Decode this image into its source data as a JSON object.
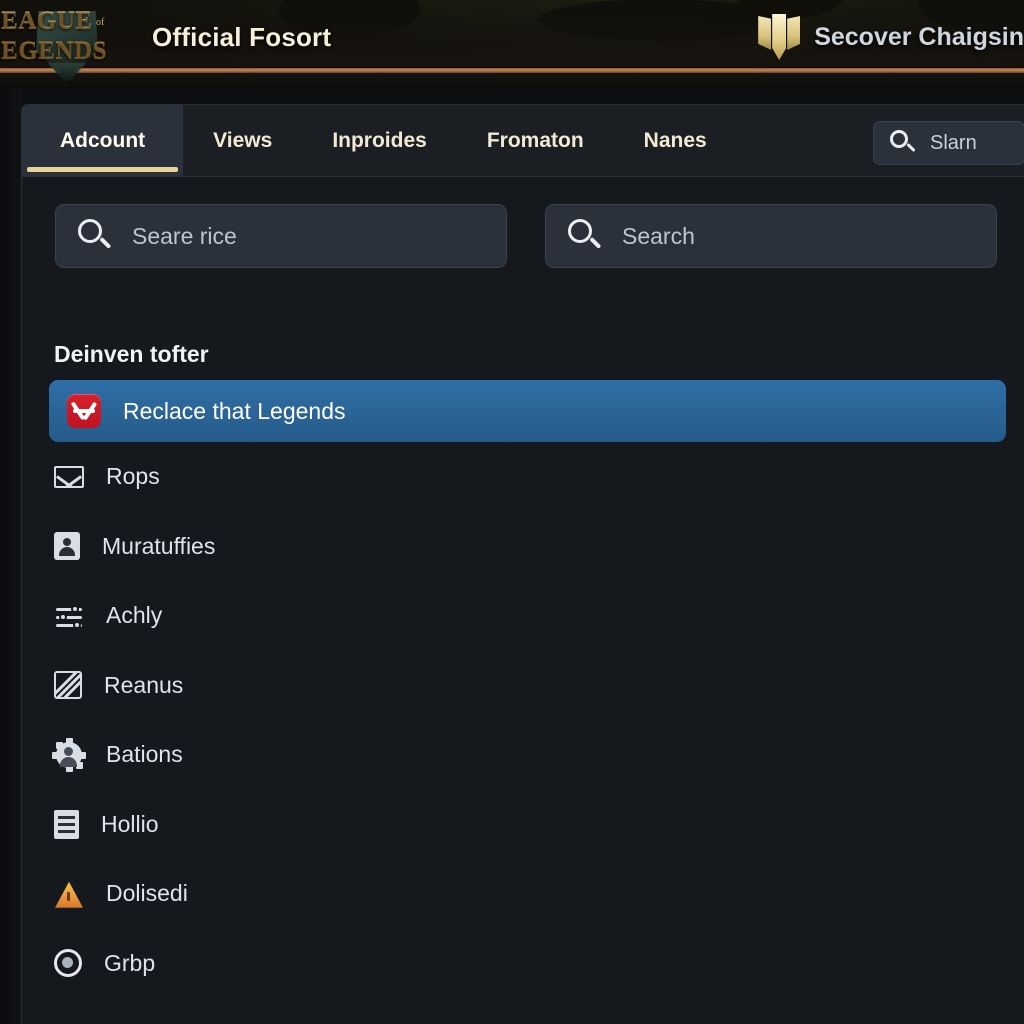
{
  "header": {
    "logo_line1": "LEAGUE",
    "logo_line2": "LEGENDS",
    "logo_of": "of",
    "title": "Official Fosort",
    "right_icon": "book-emblem-icon",
    "right_text": "Secover Chaigsin"
  },
  "tabs": [
    {
      "label": "Adcount",
      "active": true
    },
    {
      "label": "Views",
      "active": false
    },
    {
      "label": "Inproides",
      "active": false
    },
    {
      "label": "Fromaton",
      "active": false
    },
    {
      "label": "Nanes",
      "active": false
    }
  ],
  "tab_search": {
    "icon": "search-icon",
    "value": "Slarn"
  },
  "search_fields": [
    {
      "icon": "search-icon",
      "placeholder": "Seare rice"
    },
    {
      "icon": "search-icon",
      "placeholder": "Search"
    }
  ],
  "section": {
    "heading": "Deinven tofter"
  },
  "list": [
    {
      "label": "Reclace that Legends",
      "icon": "red-x-tile-icon",
      "selected": true
    },
    {
      "label": "Rops",
      "icon": "envelope-icon",
      "selected": false
    },
    {
      "label": "Muratuffies",
      "icon": "contact-card-icon",
      "selected": false
    },
    {
      "label": "Achly",
      "icon": "sliders-icon",
      "selected": false
    },
    {
      "label": "Reanus",
      "icon": "no-image-hatch-icon",
      "selected": false
    },
    {
      "label": "Bations",
      "icon": "gear-person-icon",
      "selected": false
    },
    {
      "label": "Hollio",
      "icon": "document-lines-icon",
      "selected": false
    },
    {
      "label": "Dolisedi",
      "icon": "warning-triangle-icon",
      "selected": false
    },
    {
      "label": "Grbp",
      "icon": "target-ring-icon",
      "selected": false
    }
  ],
  "colors": {
    "panel_bg": "#15181d",
    "tabbar_bg": "#1b1e22",
    "active_tab_bg": "#2b313b",
    "active_tab_underline": "#e8d39a",
    "selected_row_blue": "#2b6496",
    "input_bg": "#2a313a",
    "accent_gold": "#d4ab5c",
    "bronze_rule": "#c08a58",
    "red_tile": "#c1111f",
    "warning_orange": "#e9953b",
    "text_primary": "#dfe5ec",
    "text_placeholder": "#bcc6d1"
  }
}
